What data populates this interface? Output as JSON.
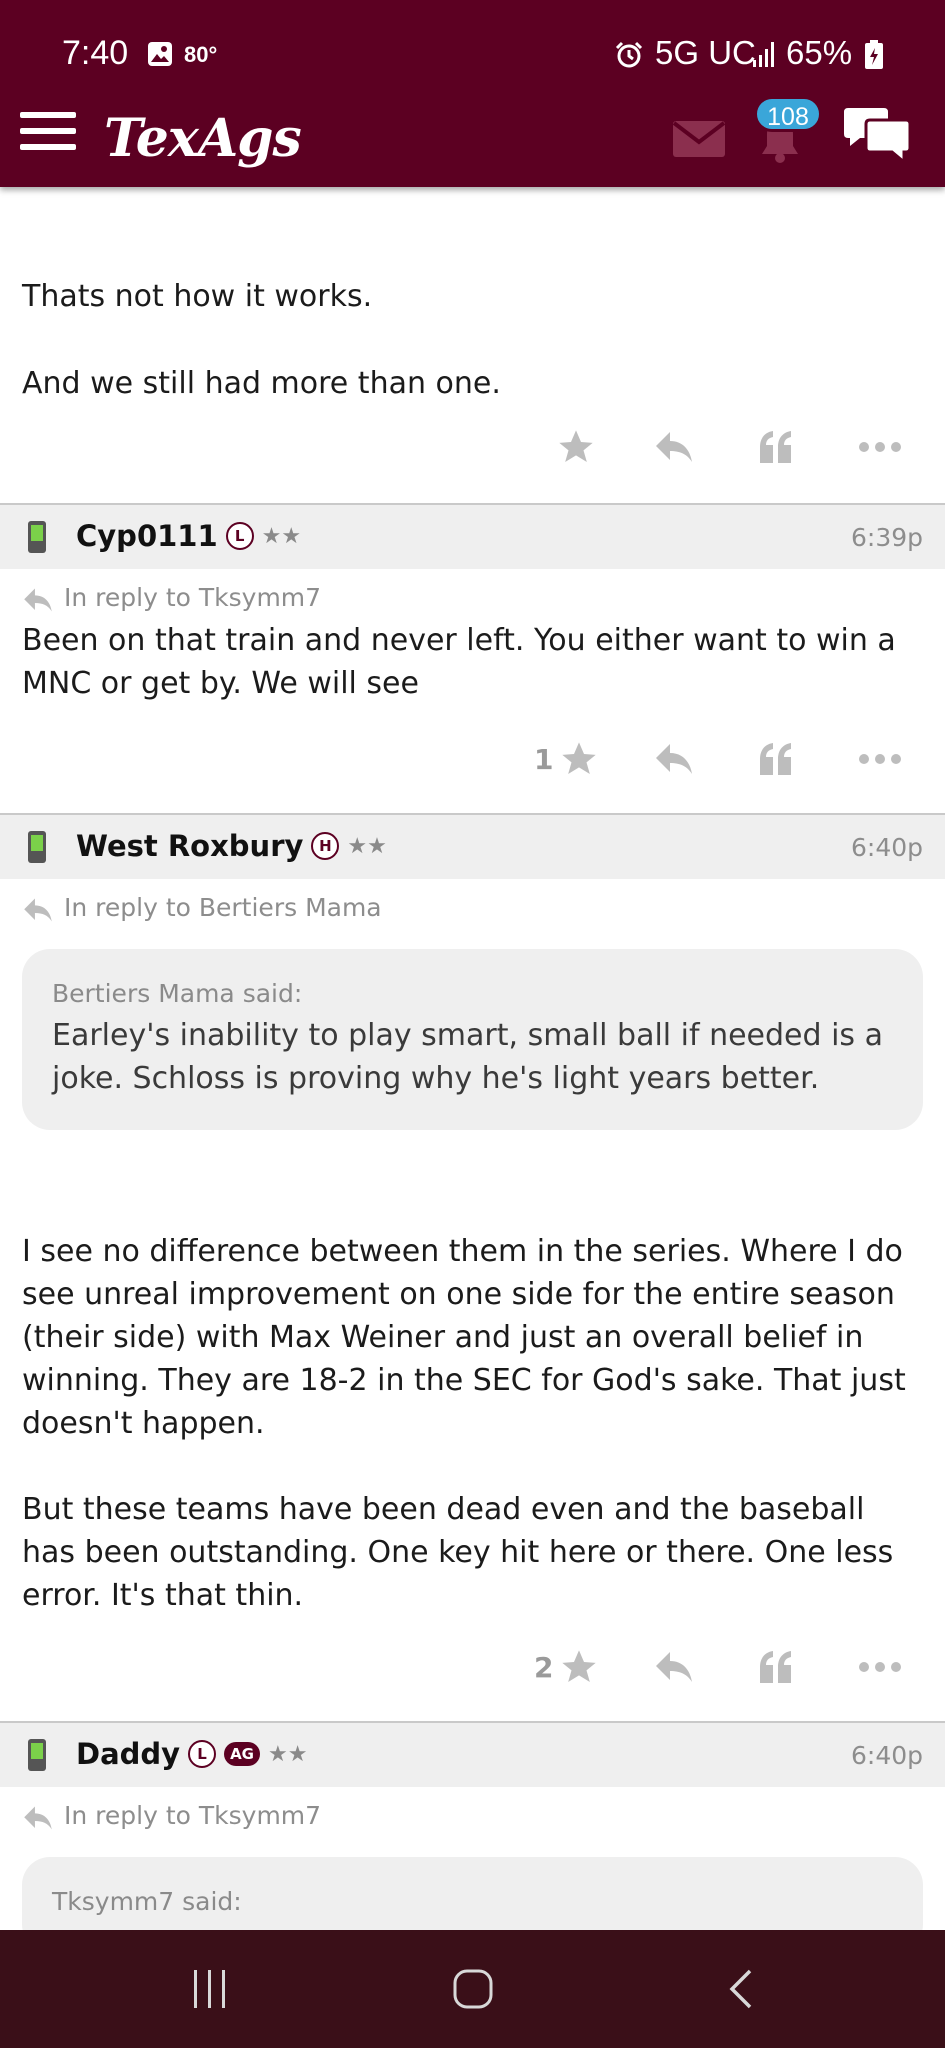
{
  "status_bar": {
    "time": "7:40",
    "temp": "80°",
    "network": "5G UC",
    "battery": "65%"
  },
  "header": {
    "logo": "TexAgs",
    "notification_count": "108",
    "accent_color": "#5c0022"
  },
  "posts": [
    {
      "lines": [
        "Thats not how it works.",
        "And we still had more than one."
      ],
      "star_count": ""
    },
    {
      "username": "Cyp0111",
      "tag": "L",
      "stars": "★★",
      "time": "6:39p",
      "reply_to": "In reply to Tksymm7",
      "body": "Been on that train and never left. You either want to win a MNC or get by. We will see",
      "star_count": "1"
    },
    {
      "username": "West Roxbury",
      "tag": "H",
      "stars": "★★",
      "time": "6:40p",
      "reply_to": "In reply to Bertiers Mama",
      "quote_author": "Bertiers Mama said:",
      "quote_text": "Earley's inability to play smart, small ball if needed is a joke. Schloss is proving why he's light years better.",
      "body1": "I see no difference between them in the series. Where I do see unreal improvement on one side for the entire season (their side) with Max Weiner and just an overall belief in winning. They are 18-2 in the SEC for God's sake. That just doesn't happen.",
      "body2": "But these teams have been dead even and the baseball has been outstanding. One key hit here or there. One less error. It's that thin.",
      "star_count": "2"
    },
    {
      "username": "Daddy",
      "tag": "L",
      "tag2": "AG",
      "stars": "★★",
      "time": "6:40p",
      "reply_to": "In reply to Tksymm7",
      "quote_author": "Tksymm7 said:"
    }
  ]
}
